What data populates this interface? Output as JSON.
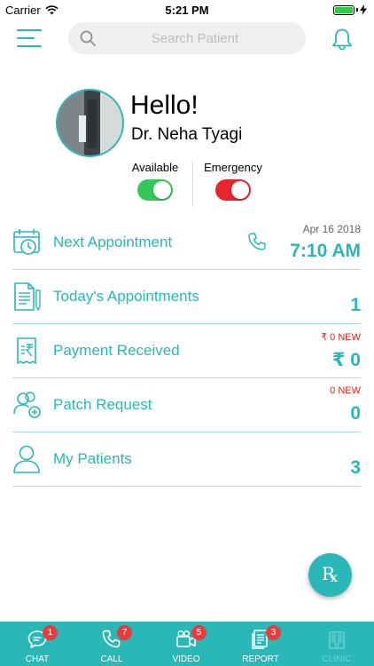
{
  "status_bar": {
    "carrier": "Carrier",
    "time": "5:21 PM",
    "battery_level": 1.0
  },
  "search": {
    "placeholder": "Search Patient"
  },
  "profile": {
    "greeting": "Hello!",
    "name": "Dr. Neha Tyagi",
    "toggles": [
      {
        "label": "Available",
        "on": true,
        "color": "#34c759"
      },
      {
        "label": "Emergency",
        "on": true,
        "color": "#e8262b"
      }
    ]
  },
  "rows": [
    {
      "icon": "calendar-clock-icon",
      "label": "Next Appointment",
      "sub": "Apr 16 2018",
      "value": "7:10 AM"
    },
    {
      "icon": "document-pen-icon",
      "label": "Today's Appointments",
      "sub": "",
      "value": "1"
    },
    {
      "icon": "receipt-rupee-icon",
      "label": "Payment Received",
      "sub": "₹ 0 NEW",
      "value": "₹ 0"
    },
    {
      "icon": "users-add-icon",
      "label": "Patch Request",
      "sub": "0 NEW",
      "value": "0"
    },
    {
      "icon": "user-icon",
      "label": "My Patients",
      "sub": "",
      "value": "3"
    }
  ],
  "fab": {
    "icon": "rx-icon",
    "r": "R",
    "x": "x"
  },
  "tabs": [
    {
      "label": "CHAT",
      "icon": "chat-icon",
      "badge": "1",
      "enabled": true
    },
    {
      "label": "CALL",
      "icon": "phone-icon",
      "badge": "7",
      "enabled": true
    },
    {
      "label": "VIDEO",
      "icon": "video-icon",
      "badge": "5",
      "enabled": true
    },
    {
      "label": "REPORT",
      "icon": "report-icon",
      "badge": "3",
      "enabled": true
    },
    {
      "label": "CLINIC",
      "icon": "clinic-icon",
      "badge": "",
      "enabled": false
    }
  ],
  "colors": {
    "accent": "#2ab7b8",
    "alert": "#e0241b"
  }
}
